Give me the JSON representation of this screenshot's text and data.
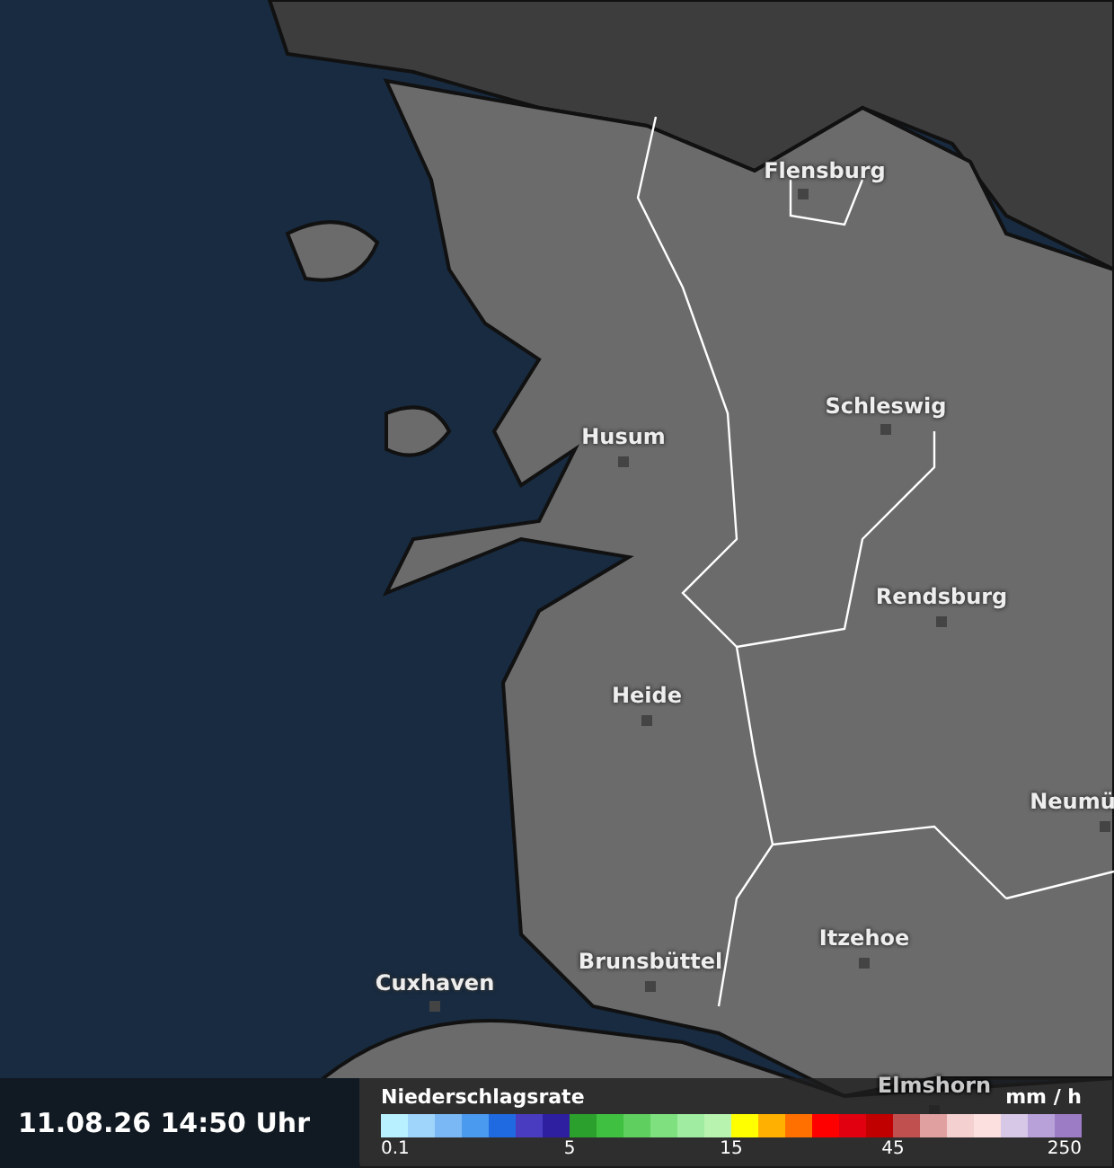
{
  "map": {
    "cities": [
      {
        "name": "Flensburg"
      },
      {
        "name": "Schleswig"
      },
      {
        "name": "Husum"
      },
      {
        "name": "Rendsburg"
      },
      {
        "name": "Heide"
      },
      {
        "name": "Neumü"
      },
      {
        "name": "Itzehoe"
      },
      {
        "name": "Cuxhaven"
      },
      {
        "name": "Brunsbüttel"
      },
      {
        "name": "Elmshorn"
      }
    ]
  },
  "timestamp": "11.08.26 14:50 Uhr",
  "legend": {
    "title": "Niederschlagsrate",
    "unit": "mm / h",
    "swatches": [
      {
        "color": "#b9f0ff"
      },
      {
        "color": "#9fd4fb"
      },
      {
        "color": "#7ab8f5"
      },
      {
        "color": "#4a9af0"
      },
      {
        "color": "#1f6ae0"
      },
      {
        "color": "#4a3cc0"
      },
      {
        "color": "#2d1fa0"
      },
      {
        "color": "#2ca02c"
      },
      {
        "color": "#40c040"
      },
      {
        "color": "#5fd05f"
      },
      {
        "color": "#7fe07f"
      },
      {
        "color": "#a0eca0"
      },
      {
        "color": "#b8f4b0"
      },
      {
        "color": "#ffff00"
      },
      {
        "color": "#ffb000"
      },
      {
        "color": "#ff7000"
      },
      {
        "color": "#ff0000"
      },
      {
        "color": "#e00010"
      },
      {
        "color": "#c00000"
      },
      {
        "color": "#c05050"
      },
      {
        "color": "#e0a0a0"
      },
      {
        "color": "#f4d0d0"
      },
      {
        "color": "#fce0e0"
      },
      {
        "color": "#d8c8e8"
      },
      {
        "color": "#b8a0d8"
      },
      {
        "color": "#9c7cc4"
      }
    ],
    "ticks": [
      {
        "label": "0.1"
      },
      {
        "label": "5"
      },
      {
        "label": "15"
      },
      {
        "label": "45"
      },
      {
        "label": "250"
      }
    ]
  }
}
